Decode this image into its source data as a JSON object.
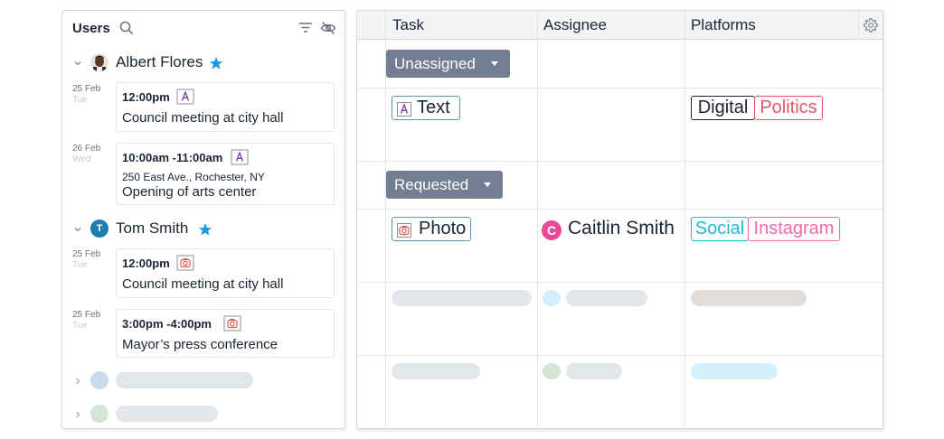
{
  "users_panel": {
    "title": "Users",
    "icons": [
      "search-icon",
      "filter-icon",
      "hide-icon"
    ],
    "users": [
      {
        "name": "Albert Flores",
        "avatar": "photo",
        "starred": true,
        "events": [
          {
            "date": "25 Feb",
            "weekday": "Tue",
            "time": "12:00pm",
            "type": "text",
            "title": "Council meeting at city hall"
          },
          {
            "date": "26 Feb",
            "weekday": "Wed",
            "time": "10:00am -11:00am",
            "type": "text",
            "location": "250 East Ave., Rochester, NY",
            "title": "Opening of arts center"
          }
        ]
      },
      {
        "name": "Tom Smith",
        "avatar_initial": "T",
        "starred": true,
        "events": [
          {
            "date": "25 Feb",
            "weekday": "Tue",
            "time": "12:00pm",
            "type": "photo",
            "title": "Council meeting at city hall"
          },
          {
            "date": "25 Feb",
            "weekday": "Tue",
            "time": "3:00pm -4:00pm",
            "type": "photo",
            "title": "Mayor’s press conference"
          }
        ]
      }
    ]
  },
  "table": {
    "columns": [
      "Task",
      "Assignee",
      "Platforms"
    ],
    "groups": [
      {
        "status": "Unassigned",
        "rows": [
          {
            "task": "Text",
            "task_icon": "text-icon",
            "assignee": "",
            "platforms": [
              "Digital",
              "Politics"
            ]
          }
        ]
      },
      {
        "status": "Requested",
        "rows": [
          {
            "task": "Photo",
            "task_icon": "camera-icon",
            "assignee": "Caitlin Smith",
            "assignee_initial": "C",
            "platforms": [
              "Social",
              "Instagram"
            ]
          }
        ]
      }
    ]
  },
  "colors": {
    "text_tag": "#5b9bb8",
    "text_icon": "#7b3fa0",
    "photo_tag": "#5b9bb8",
    "photo_icon": "#e05a4f",
    "digital": "#1c2333",
    "politics": "#e05a6a",
    "social": "#22b8cf",
    "instagram": "#ec6aa8",
    "status_button": "#737e92",
    "star": "#1e9be0",
    "assignee_avatar": "#ec4899"
  }
}
